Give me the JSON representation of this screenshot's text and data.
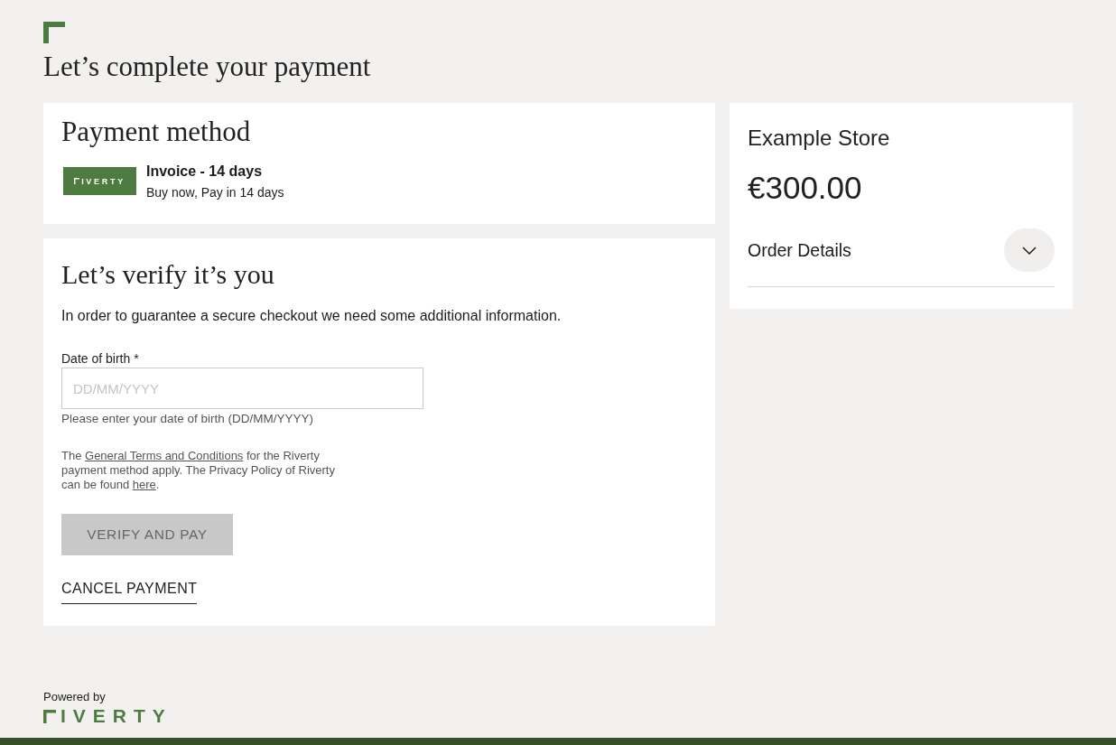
{
  "page_title": "Let’s complete your payment",
  "payment_method": {
    "title": "Payment method",
    "logo_text": "IVERTY",
    "name": "Invoice - 14 days",
    "description": "Buy now, Pay in 14 days"
  },
  "verification": {
    "title": "Let’s verify it’s you",
    "intro": "In order to guarantee a secure checkout we need some additional information.",
    "field": {
      "label": "Date of birth *",
      "placeholder": "DD/MM/YYYY",
      "hint": "Please enter your date of birth (DD/MM/YYYY)"
    },
    "terms": [
      {
        "kind": "text",
        "text": "The "
      },
      {
        "kind": "link",
        "text": "General Terms and Conditions"
      },
      {
        "kind": "text",
        "text": " for the Riverty payment method apply. The Privacy Policy of Riverty can be found "
      },
      {
        "kind": "link",
        "text": "here"
      },
      {
        "kind": "text",
        "text": "."
      }
    ],
    "submit": {
      "label": "VERIFY AND PAY",
      "disabled": true
    },
    "cancel": {
      "label": "CANCEL PAYMENT"
    }
  },
  "summary": {
    "store": "Example Store",
    "amount": "€300.00",
    "order_details": {
      "label": "Order Details",
      "expanded": false
    }
  },
  "footer": {
    "powered_by": "Powered by",
    "logo_text": "IVERTY"
  }
}
